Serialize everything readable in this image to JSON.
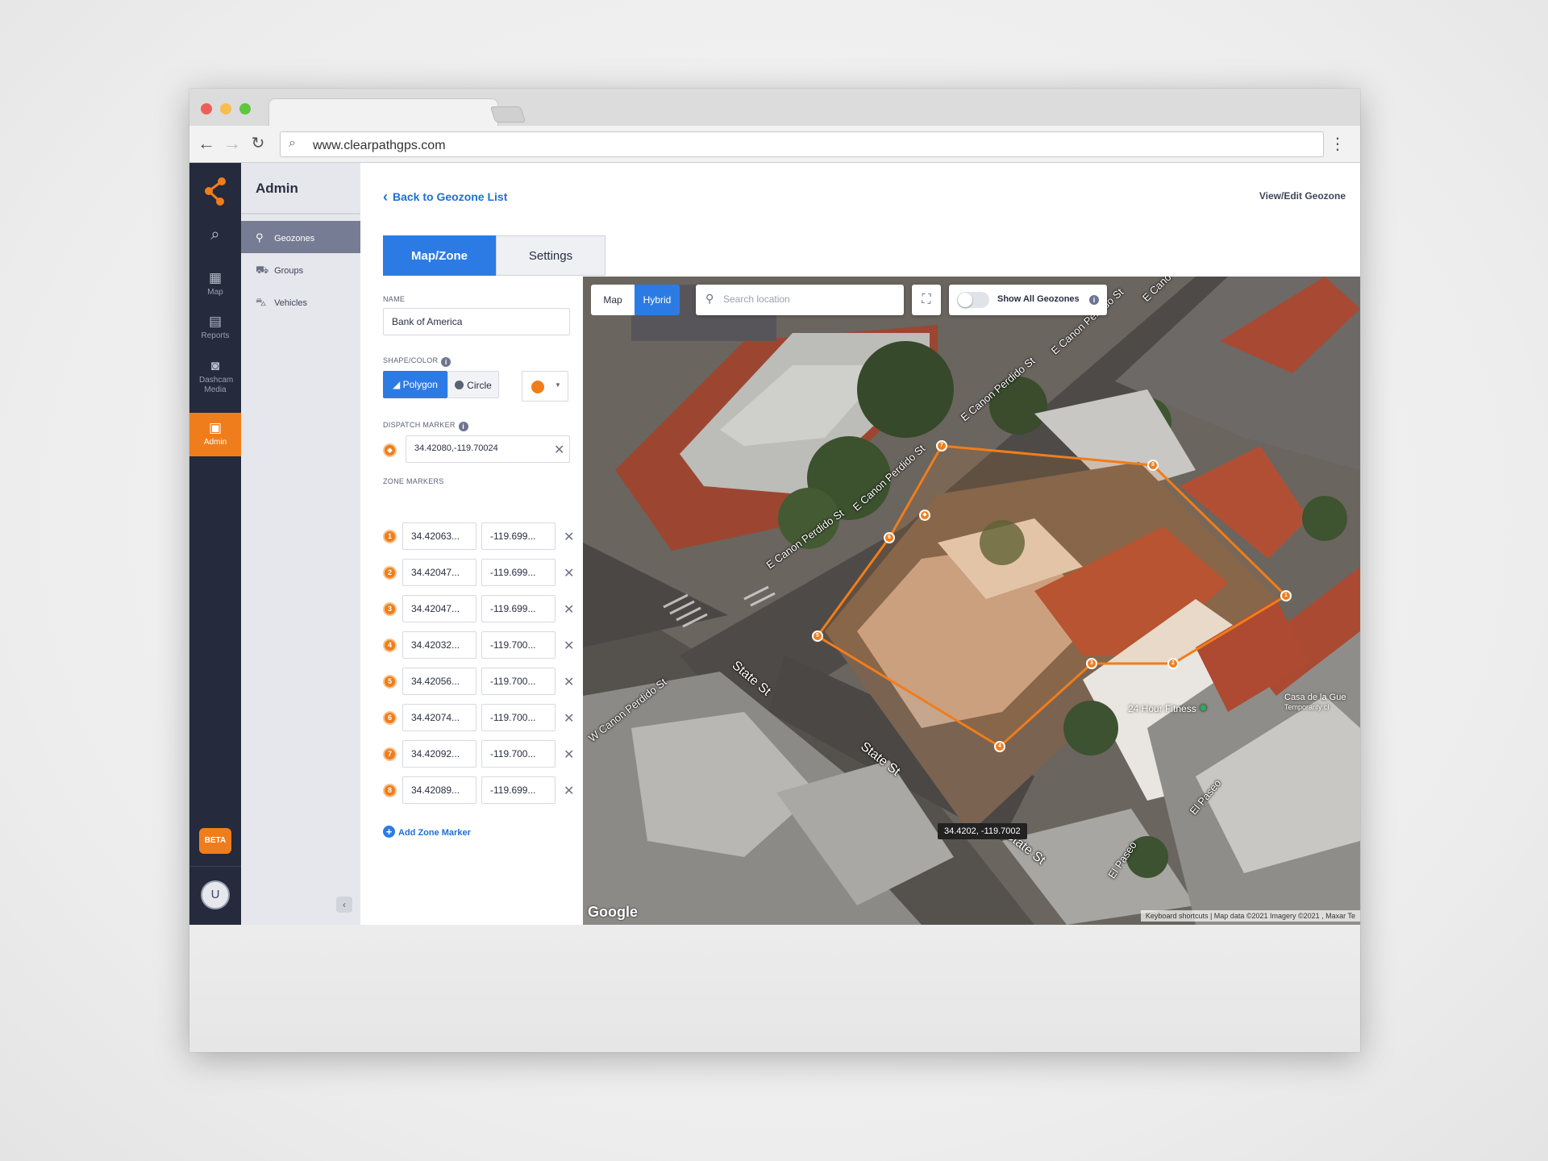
{
  "browser": {
    "url": "www.clearpathgps.com",
    "back_icon": "arrow-left-icon",
    "forward_icon": "arrow-right-icon",
    "reload_icon": "reload-icon",
    "colors": {
      "close": "#ec5f57",
      "minimize": "#f5be4f",
      "zoom": "#5fc73f"
    }
  },
  "rail": {
    "items": [
      {
        "label": "",
        "icon": "search-icon"
      },
      {
        "label": "Map",
        "icon": "map-icon"
      },
      {
        "label": "Reports",
        "icon": "document-icon"
      },
      {
        "label": "Dashcam Media",
        "icon": "camera-icon"
      },
      {
        "label": "Admin",
        "icon": "admin-icon"
      }
    ],
    "beta_label": "BETA",
    "avatar_initial": "U"
  },
  "subnav": {
    "title": "Admin",
    "items": [
      {
        "label": "Geozones",
        "icon": "pin-icon",
        "active": true
      },
      {
        "label": "Groups",
        "icon": "cars-icon",
        "active": false
      },
      {
        "label": "Vehicles",
        "icon": "car-icon",
        "active": false
      }
    ]
  },
  "header": {
    "back_label": "Back to Geozone List",
    "view_edit_label": "View/Edit Geozone"
  },
  "tabs": [
    {
      "label": "Map/Zone",
      "active": true
    },
    {
      "label": "Settings",
      "active": false
    }
  ],
  "form": {
    "name_label": "NAME",
    "name_value": "Bank of America",
    "shape_label": "SHAPE/COLOR",
    "shape_options": [
      "Polygon",
      "Circle"
    ],
    "shape_selected": "Polygon",
    "zone_color": "#f07d1b",
    "dispatch_label": "DISPATCH MARKER",
    "dispatch_value": "34.42080,-119.70024",
    "zone_markers_label": "ZONE MARKERS",
    "zone_markers": [
      {
        "n": "1",
        "lat": "34.42063...",
        "lng": "-119.699..."
      },
      {
        "n": "2",
        "lat": "34.42047...",
        "lng": "-119.699..."
      },
      {
        "n": "3",
        "lat": "34.42047...",
        "lng": "-119.699..."
      },
      {
        "n": "4",
        "lat": "34.42032...",
        "lng": "-119.700..."
      },
      {
        "n": "5",
        "lat": "34.42056...",
        "lng": "-119.700..."
      },
      {
        "n": "6",
        "lat": "34.42074...",
        "lng": "-119.700..."
      },
      {
        "n": "7",
        "lat": "34.42092...",
        "lng": "-119.700..."
      },
      {
        "n": "8",
        "lat": "34.42089...",
        "lng": "-119.699..."
      }
    ],
    "add_marker_label": "Add Zone Marker"
  },
  "map": {
    "type_options": [
      "Map",
      "Hybrid"
    ],
    "type_selected": "Hybrid",
    "search_placeholder": "Search location",
    "show_all_label": "Show All Geozones",
    "show_all_on": false,
    "cursor_coords": "34.4202, -119.7002",
    "street_labels": {
      "perdido_1": "E Canon Perdido St",
      "perdido_2": "E Canon Perdido St",
      "perdido_3": "E Canon Perdido St",
      "perdido_4": "E Canon Perdido St",
      "perdido_5": "E Cano",
      "w_perdido": "W Canon Perdido St",
      "state_1": "State St",
      "state_2": "State St",
      "state_3": "State St",
      "el_paseo_1": "El Paseo",
      "el_paseo_2": "El Paseo"
    },
    "poi_fitness": "24 Hour Fitness",
    "poi_casa": "Casa de la Gue",
    "poi_casa_sub": "Temporarily cl",
    "google_logo": "Google",
    "attribution": "Keyboard shortcuts | Map data ©2021 Imagery ©2021 , Maxar Te"
  }
}
